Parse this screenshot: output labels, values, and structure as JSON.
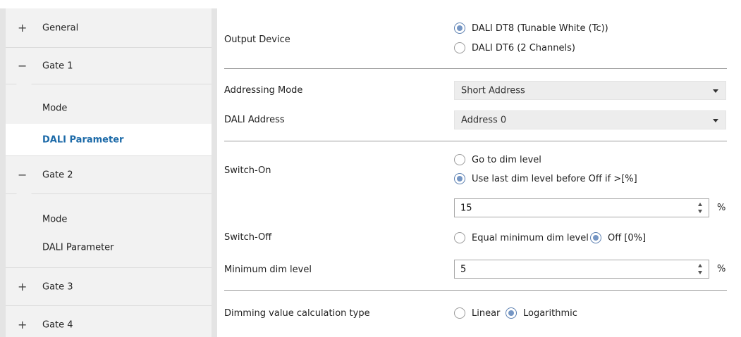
{
  "sidebar": {
    "items": [
      {
        "sign": "+",
        "label": "General"
      },
      {
        "sign": "−",
        "label": "Gate 1"
      },
      {
        "label": "Mode"
      },
      {
        "label": "DALI Parameter"
      },
      {
        "sign": "−",
        "label": "Gate 2"
      },
      {
        "label": "Mode"
      },
      {
        "label": "DALI Parameter"
      },
      {
        "sign": "+",
        "label": "Gate 3"
      },
      {
        "sign": "+",
        "label": "Gate 4"
      }
    ]
  },
  "main": {
    "output_device": {
      "label": "Output Device",
      "options": [
        "DALI DT8 (Tunable White (Tc))",
        "DALI DT6 (2 Channels)"
      ],
      "selected": "DALI DT8 (Tunable White (Tc))"
    },
    "addressing_mode": {
      "label": "Addressing Mode",
      "value": "Short Address"
    },
    "dali_address": {
      "label": "DALI Address",
      "value": "Address 0"
    },
    "switch_on": {
      "label": "Switch-On",
      "options": [
        "Go to dim level",
        "Use last dim level before Off if >[%]"
      ],
      "selected": "Use last dim level before Off if >[%]",
      "value": "15",
      "unit": "%"
    },
    "switch_off": {
      "label": "Switch-Off",
      "options": [
        "Equal minimum dim level",
        "Off [0%]"
      ],
      "selected": "Off [0%]"
    },
    "min_dim_level": {
      "label": "Minimum dim level",
      "value": "5",
      "unit": "%"
    },
    "dimming_calc": {
      "label": "Dimming value calculation type",
      "options": [
        "Linear",
        "Logarithmic"
      ],
      "selected": "Logarithmic"
    }
  },
  "colors": {
    "active_text": "#1c6aa8",
    "sidebar_bg": "#f2f2f2",
    "radio_dot": "#7596c4"
  }
}
